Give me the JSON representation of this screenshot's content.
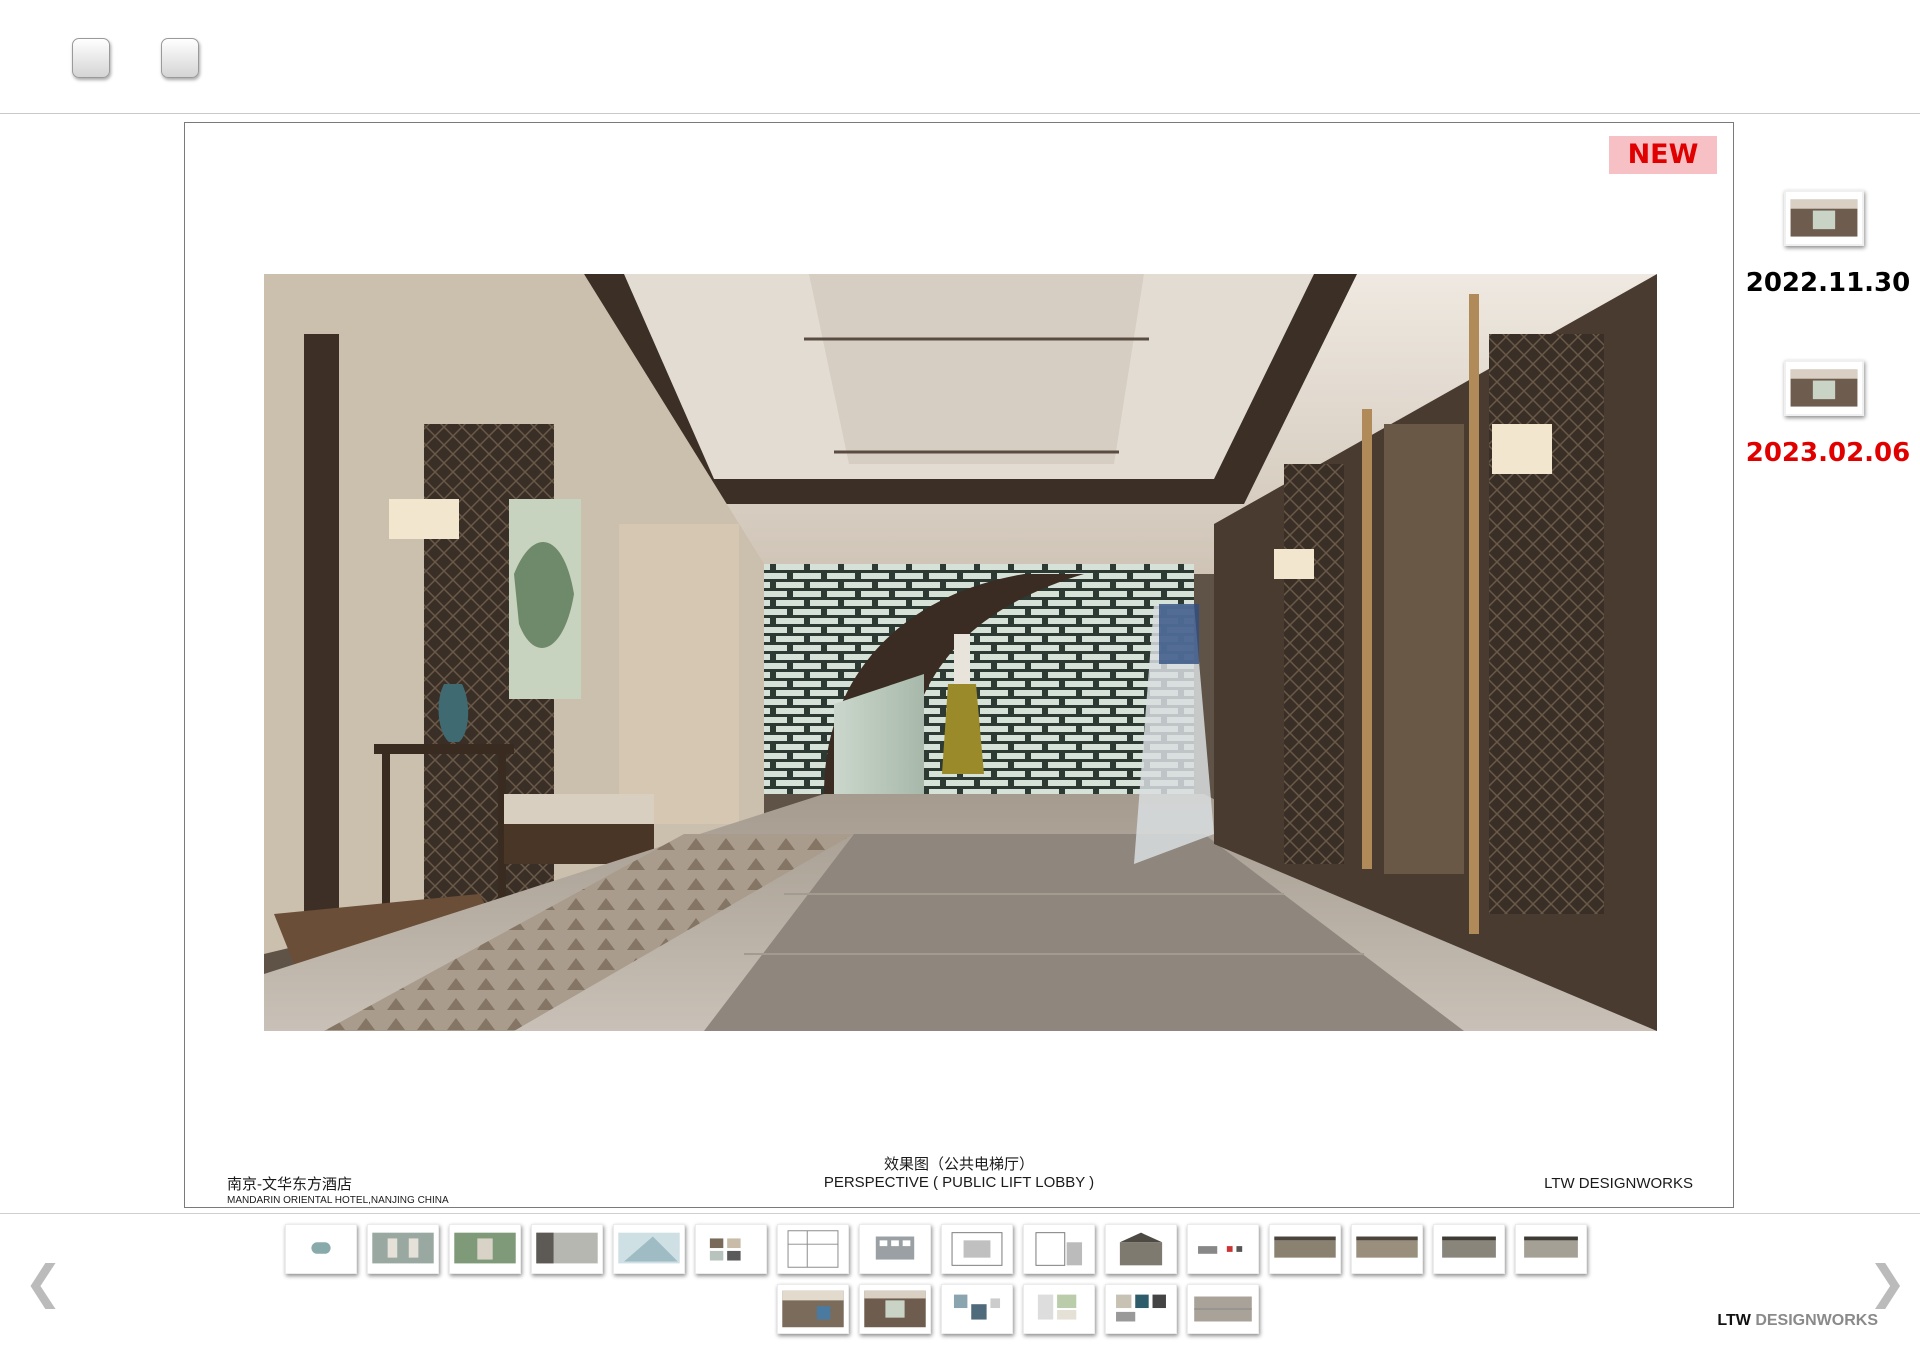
{
  "toolbar": {
    "buttons": [
      {
        "icon": "square-button-icon"
      },
      {
        "icon": "square-button-icon"
      }
    ]
  },
  "slide": {
    "badge": "NEW",
    "footer": {
      "project_cn": "南京-文华东方酒店",
      "project_en": "MANDARIN ORIENTAL HOTEL,NANJING CHINA",
      "title_cn": "效果图（公共电梯厅）",
      "title_en": "PERSPECTIVE ( PUBLIC LIFT LOBBY )",
      "company": "LTW DESIGNWORKS"
    }
  },
  "versions": [
    {
      "date": "2022.11.30",
      "color": "#111111"
    },
    {
      "date": "2023.02.06",
      "color": "#e00000"
    }
  ],
  "navigation": {
    "prev_icon": "chevron-left-icon",
    "next_icon": "chevron-right-icon",
    "prev_glyph": "❮",
    "next_glyph": "❯"
  },
  "brand": {
    "bold": "LTW",
    "light": "DESIGNWORKS"
  }
}
